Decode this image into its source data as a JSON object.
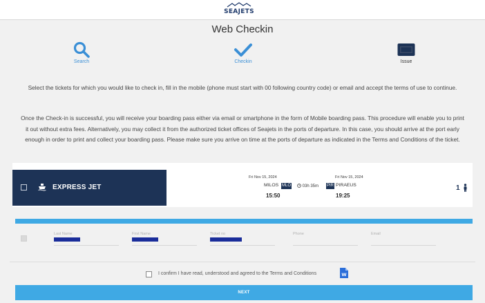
{
  "brand": {
    "logo_text": "SEAJETS"
  },
  "page": {
    "title": "Web Checkin"
  },
  "steps": [
    {
      "label": "Search",
      "icon": "search-icon"
    },
    {
      "label": "Checkin",
      "icon": "check-icon"
    },
    {
      "label": "Issue",
      "icon": "ticket-icon"
    }
  ],
  "instructions": {
    "line1": "Select the tickets for which you would like to check in, fill in the mobile (phone must start with 00 following country code) or email and accept the terms of use to continue.",
    "line2": "Once the Check-in is successful, you will receive your boarding pass either via email or smartphone in the form of Mobile boarding pass. This procedure will enable you to print it out without extra fees. Alternatively, you may collect it from the authorized ticket offices of Seajets in the ports of departure. In this case, you should arrive at the port early enough in order to print and collect your boarding pass. Please make sure you arrive on time at the ports of departure as indicated in the Terms and Conditions of the ticket."
  },
  "ticket": {
    "vessel": "EXPRESS JET",
    "departure": {
      "date": "Fri Nov 15, 2024",
      "port": "MILOS",
      "code": "MLO",
      "time": "15:50"
    },
    "duration": "03h 35m",
    "arrival": {
      "date": "Fri Nov 15, 2024",
      "port": "PIRAEUS",
      "code": "PIR",
      "time": "19:25"
    },
    "passengers": "1"
  },
  "passenger_fields": [
    {
      "placeholder": "Last Name",
      "redacted": true
    },
    {
      "placeholder": "First Name",
      "redacted": true
    },
    {
      "placeholder": "Ticket no",
      "redacted": true
    },
    {
      "placeholder": "Phone",
      "redacted": false
    },
    {
      "placeholder": "Email",
      "redacted": false
    }
  ],
  "terms": {
    "label": "I confirm I have read, understood and agreed to the Terms and Conditions"
  },
  "actions": {
    "next": "NEXT"
  },
  "colors": {
    "accent_blue": "#3fa9e4",
    "navy": "#1d3356",
    "redaction": "#1a2d9a"
  }
}
